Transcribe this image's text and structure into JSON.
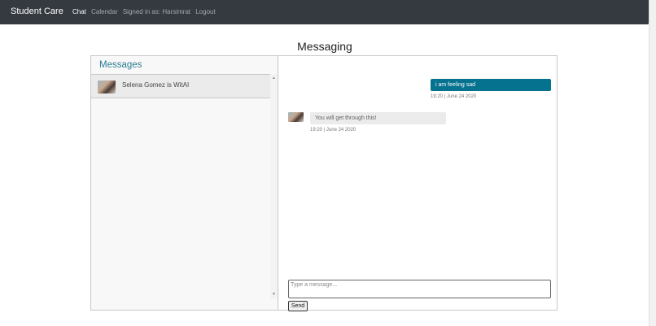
{
  "navbar": {
    "brand": "Student Care",
    "links": [
      {
        "label": "Chat"
      },
      {
        "label": "Calendar"
      },
      {
        "label": "Signed in as: Harsimrat"
      },
      {
        "label": "Logout"
      }
    ]
  },
  "page": {
    "title": "Messaging"
  },
  "inbox": {
    "heading": "Messages",
    "chats": [
      {
        "name": "Selena Gomez is WitAI"
      }
    ]
  },
  "messages": {
    "outgoing": [
      {
        "text": "i am feeling sad",
        "time": "19:20 | June 24 2020"
      }
    ],
    "incoming": [
      {
        "text": "You will get through this!",
        "time": "19:20 | June 24 2020"
      }
    ]
  },
  "composer": {
    "placeholder": "Type a message...",
    "send_label": "Send"
  },
  "colors": {
    "navbar": "#343a40",
    "accent": "#05728f",
    "heading": "#2a7d93"
  }
}
